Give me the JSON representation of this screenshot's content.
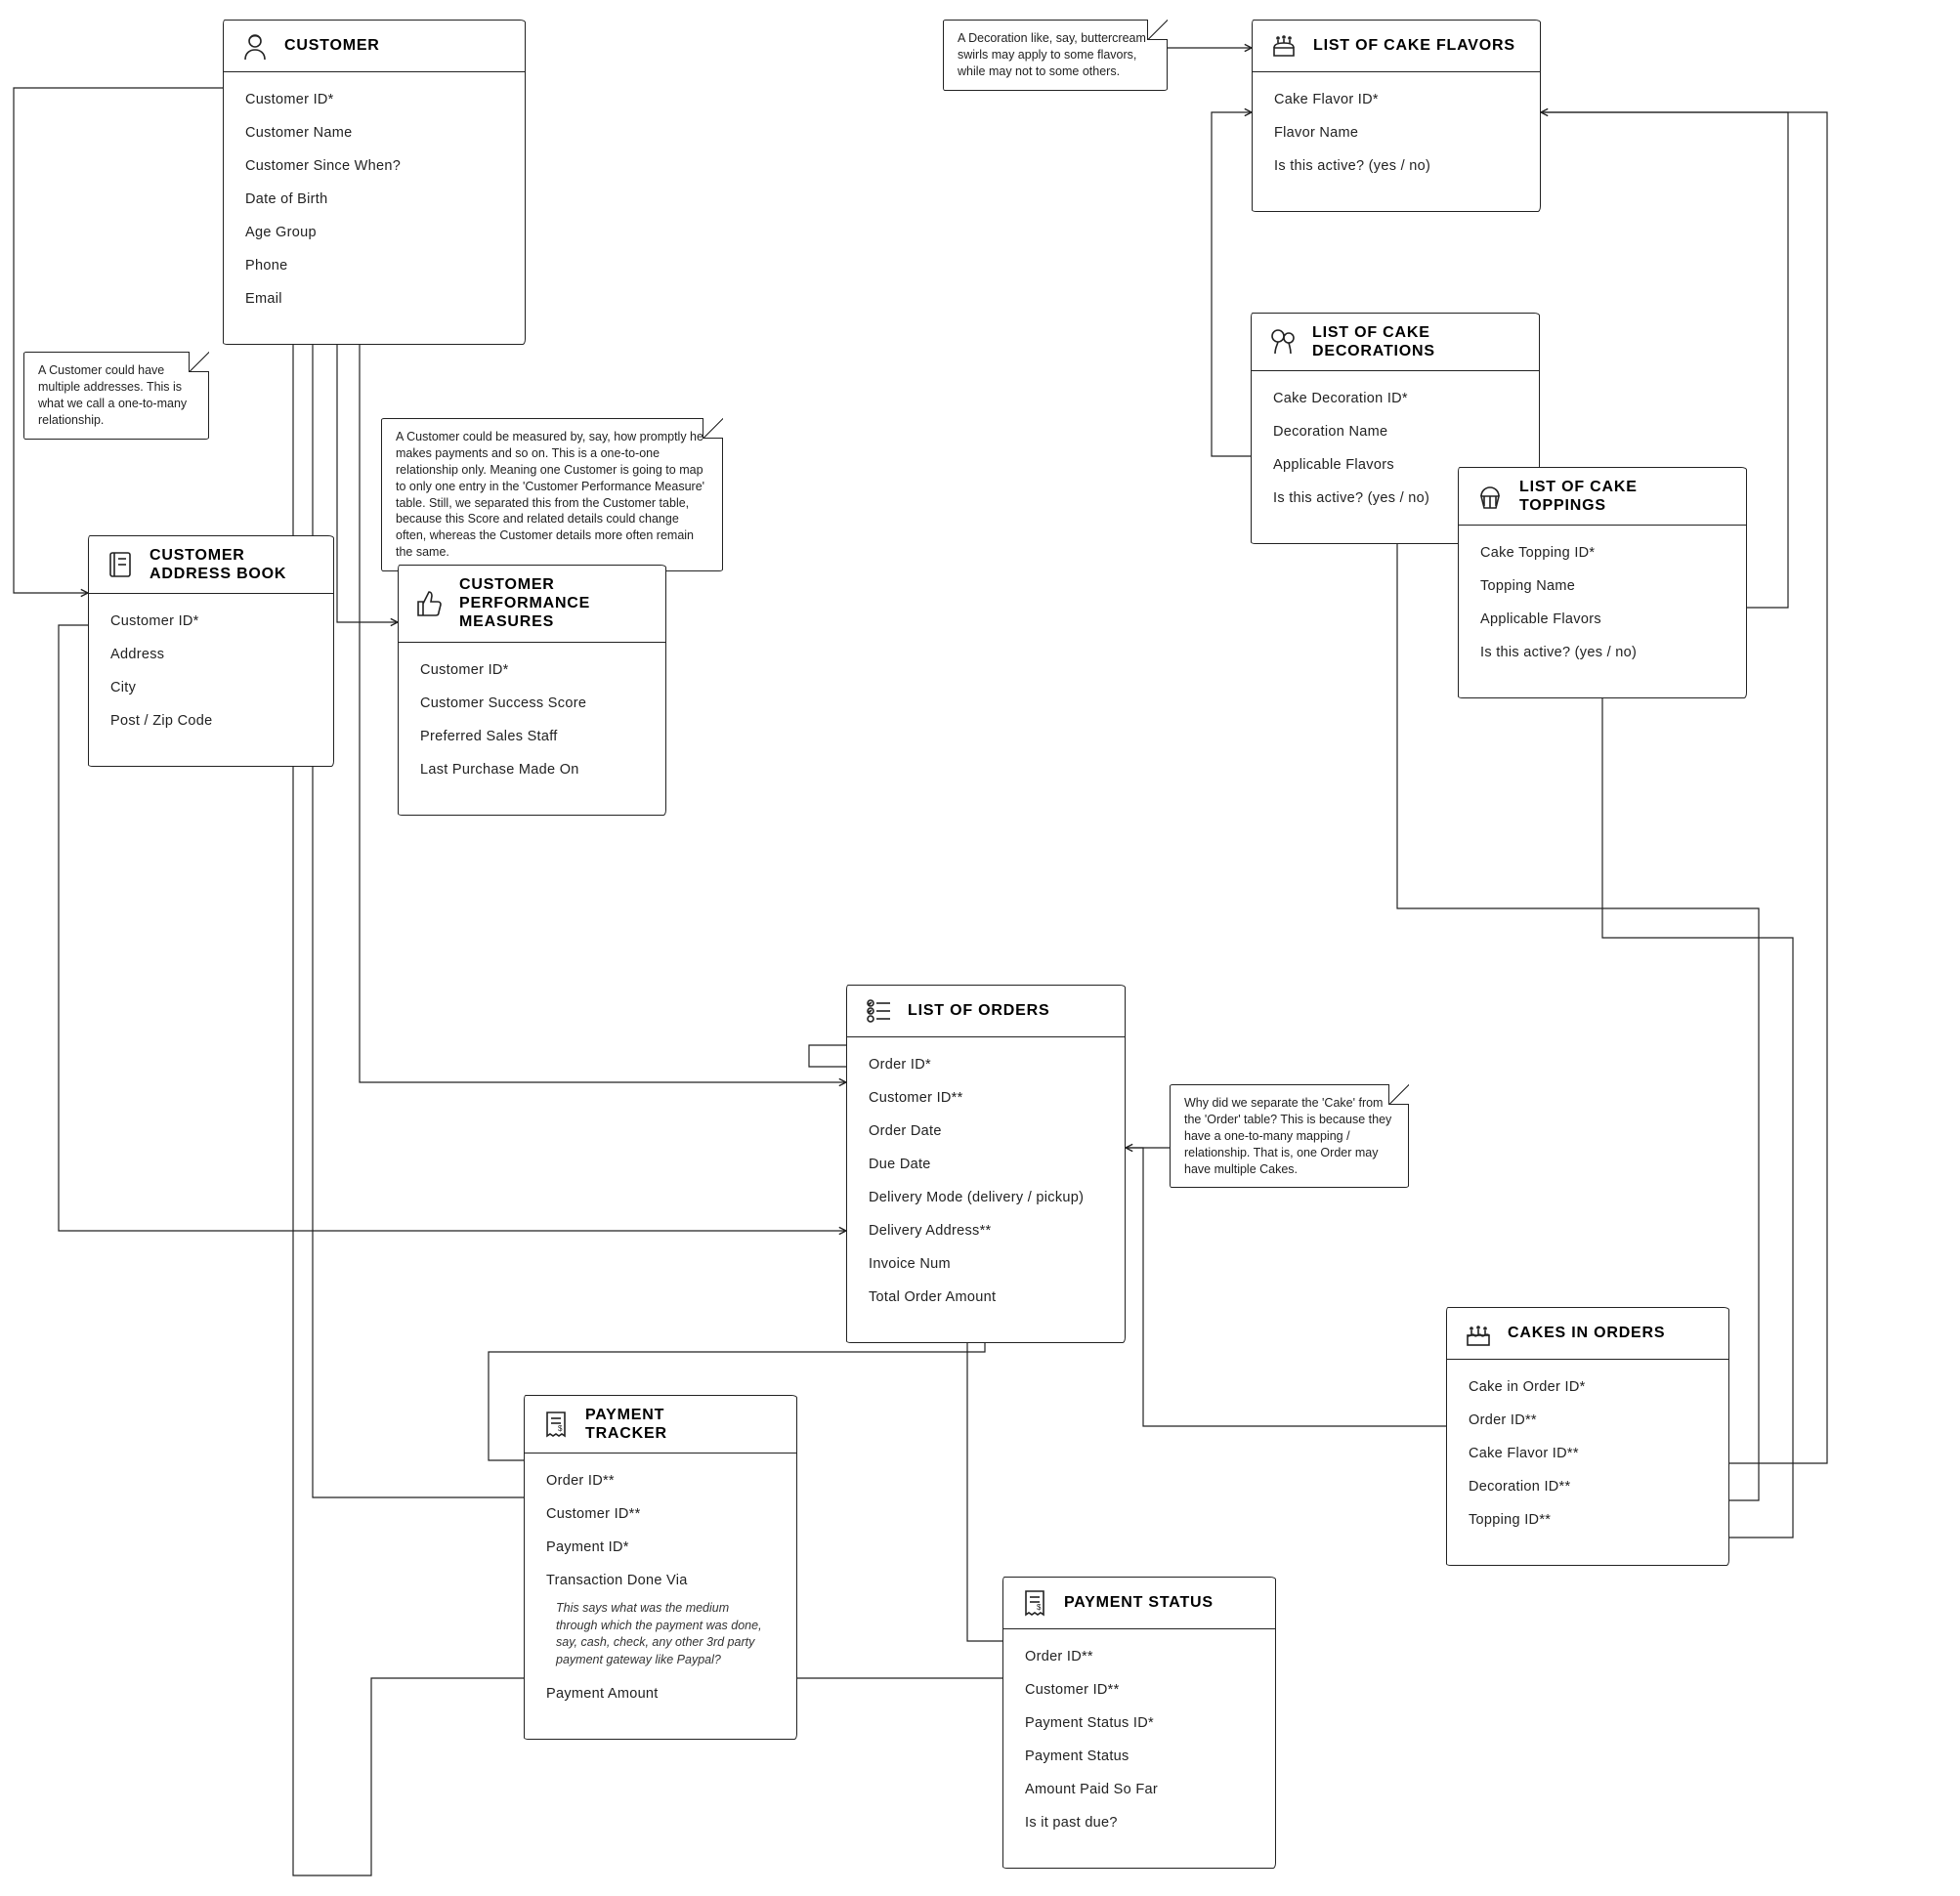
{
  "entities": {
    "customer": {
      "title": "CUSTOMER",
      "fields": [
        "Customer ID*",
        "Customer Name",
        "Customer Since When?",
        "Date of Birth",
        "Age Group",
        "Phone",
        "Email"
      ]
    },
    "addressBook": {
      "title": "CUSTOMER ADDRESS BOOK",
      "fields": [
        "Customer ID*",
        "Address",
        "City",
        "Post / Zip Code"
      ]
    },
    "perfMeasures": {
      "title": "CUSTOMER PERFORMANCE MEASURES",
      "fields": [
        "Customer ID*",
        "Customer Success Score",
        "Preferred Sales Staff",
        "Last Purchase Made On"
      ]
    },
    "flavors": {
      "title": "LIST OF CAKE FLAVORS",
      "fields": [
        "Cake Flavor ID*",
        "Flavor Name",
        "Is this active? (yes / no)"
      ]
    },
    "decorations": {
      "title": "LIST OF CAKE DECORATIONS",
      "fields": [
        "Cake Decoration ID*",
        "Decoration Name",
        "Applicable Flavors",
        "Is this active? (yes / no)"
      ]
    },
    "toppings": {
      "title": "LIST OF CAKE TOPPINGS",
      "fields": [
        "Cake Topping ID*",
        "Topping Name",
        "Applicable Flavors",
        "Is this active? (yes / no)"
      ]
    },
    "orders": {
      "title": "LIST OF ORDERS",
      "fields": [
        "Order ID*",
        "Customer ID**",
        "Order Date",
        "Due Date",
        "Delivery Mode (delivery / pickup)",
        "Delivery Address**",
        "Invoice Num",
        "Total Order Amount"
      ]
    },
    "cakesInOrders": {
      "title": "CAKES IN ORDERS",
      "fields": [
        "Cake in Order ID*",
        "Order ID**",
        "Cake Flavor ID**",
        "Decoration ID**",
        "Topping ID**"
      ]
    },
    "paymentTracker": {
      "title": "PAYMENT TRACKER",
      "fields": [
        "Order ID**",
        "Customer ID**",
        "Payment ID*",
        "Transaction Done Via"
      ],
      "fieldNote": "This says what was the medium through which the payment was done, say, cash, check, any other 3rd party payment gateway like Paypal?",
      "fieldsAfter": [
        "Payment Amount"
      ]
    },
    "paymentStatus": {
      "title": "PAYMENT STATUS",
      "fields": [
        "Order ID**",
        "Customer ID**",
        "Payment Status ID*",
        "Payment Status",
        "Amount Paid So Far",
        "Is it past due?"
      ]
    }
  },
  "notes": {
    "n1": "A Customer could have multiple addresses. This is what we call a one-to-many relationship.",
    "n2": "A Customer could be measured by, say, how promptly he makes payments and so on. This is a one-to-one relationship only. Meaning one Customer is going to map to only one entry in the 'Customer Performance Measure' table. Still, we separated this from the Customer table, because this Score and related details could change often, whereas the Customer details more often remain the same.",
    "n3": "A Decoration like, say, buttercream swirls may apply to some flavors, while may not to some others.",
    "n4": "Why did we separate the 'Cake' from the 'Order' table? This is because they have a one-to-many mapping / relationship. That is, one Order may have multiple Cakes."
  }
}
